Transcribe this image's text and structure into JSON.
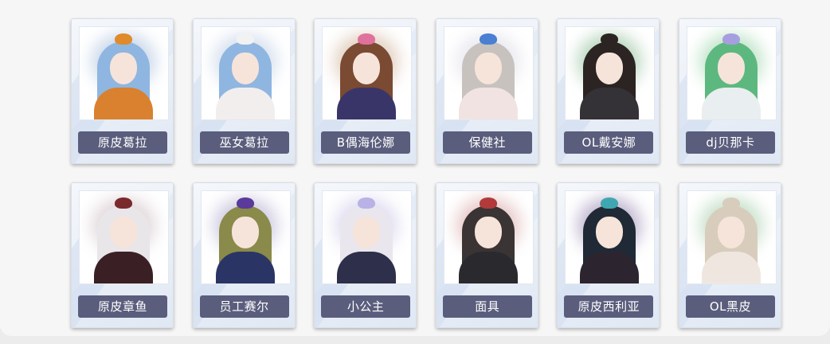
{
  "cards": [
    {
      "name": "原皮葛拉",
      "portrait": {
        "hair": "#8fb6e0",
        "body": "#d9812e",
        "accent": "#e08a2a",
        "glow": "#9fb7d9"
      }
    },
    {
      "name": "巫女葛拉",
      "portrait": {
        "hair": "#8fb6e0",
        "body": "#f3eeee",
        "accent": "#f2f2f2",
        "glow": "#b7c8e2"
      }
    },
    {
      "name": "B偶海伦娜",
      "portrait": {
        "hair": "#7a4a33",
        "body": "#3a3568",
        "accent": "#e0709c",
        "glow": "#c9a98e"
      }
    },
    {
      "name": "保健社",
      "portrait": {
        "hair": "#c8c2bf",
        "body": "#f2e3e3",
        "accent": "#4a7fd2",
        "glow": "#d7d7e3"
      }
    },
    {
      "name": "OL戴安娜",
      "portrait": {
        "hair": "#2c2422",
        "body": "#343236",
        "accent": "#2c2422",
        "glow": "#7fb48a"
      }
    },
    {
      "name": "dj贝那卡",
      "portrait": {
        "hair": "#5db87f",
        "body": "#e9eef0",
        "accent": "#a79ee0",
        "glow": "#8fcf9f"
      }
    },
    {
      "name": "原皮章鱼",
      "portrait": {
        "hair": "#e9e6ea",
        "body": "#3a2024",
        "accent": "#7a2a2c",
        "glow": "#c9b7bb"
      }
    },
    {
      "name": "员工赛尔",
      "portrait": {
        "hair": "#8a8a4a",
        "body": "#2a3566",
        "accent": "#5a3a9a",
        "glow": "#a7a2c9"
      }
    },
    {
      "name": "小公主",
      "portrait": {
        "hair": "#e9e6ee",
        "body": "#2e2f4a",
        "accent": "#b8b2e6",
        "glow": "#c8c2e4"
      }
    },
    {
      "name": "面具",
      "portrait": {
        "hair": "#3a3434",
        "body": "#2a2a2e",
        "accent": "#b23a3a",
        "glow": "#d49a9a"
      }
    },
    {
      "name": "原皮西利亚",
      "portrait": {
        "hair": "#1f2a36",
        "body": "#2c2530",
        "accent": "#3fa7b0",
        "glow": "#8c7aa8"
      }
    },
    {
      "name": "OL黑皮",
      "portrait": {
        "hair": "#d8cdbd",
        "body": "#efe7df",
        "accent": "#d8cdbd",
        "glow": "#9fc9a3"
      }
    }
  ]
}
